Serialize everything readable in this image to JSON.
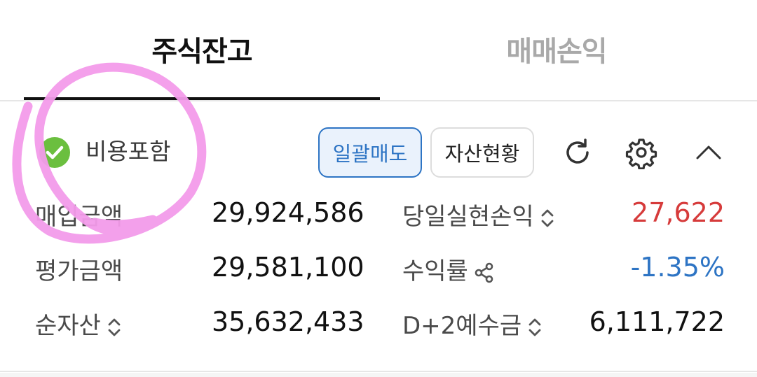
{
  "tabs": [
    {
      "label": "주식잔고",
      "active": true
    },
    {
      "label": "매매손익",
      "active": false
    }
  ],
  "options": {
    "include_costs_label": "비용포함",
    "include_costs_checked": true
  },
  "toolbar": {
    "sell_all_label": "일괄매도",
    "asset_status_label": "자산현황",
    "refresh_icon": "refresh-icon",
    "settings_icon": "gear-icon",
    "collapse_icon": "chevron-up-icon"
  },
  "summary": {
    "left": [
      {
        "label": "매입금액",
        "value": "29,924,586"
      },
      {
        "label": "평가금액",
        "value": "29,581,100"
      },
      {
        "label": "순자산",
        "value": "35,632,433"
      }
    ],
    "right": [
      {
        "label": "당일실현손익",
        "value": "27,622",
        "value_color": "#d63b3b"
      },
      {
        "label": "수익률",
        "value": "-1.35%",
        "value_color": "#2d74c4"
      },
      {
        "label": "D+2예수금",
        "value": "6,111,722",
        "value_color": "#111111"
      }
    ]
  },
  "colors": {
    "accent": "#2d74c4",
    "positive": "#d63b3b",
    "negative": "#2d74c4",
    "check": "#6bbf3f",
    "annotation": "#f39bea"
  }
}
